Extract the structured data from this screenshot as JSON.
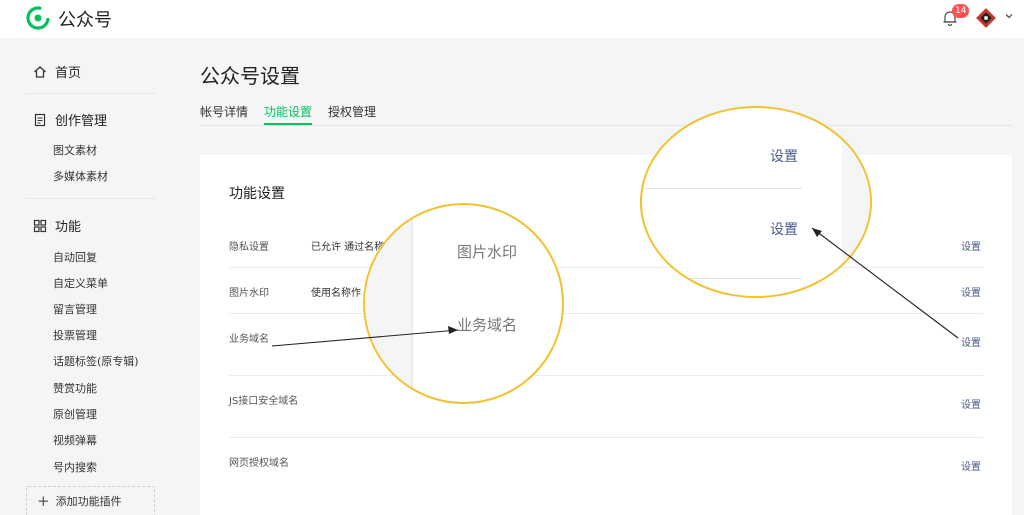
{
  "header": {
    "brand": "公众号",
    "notification_count": "14",
    "brand_color": "#07c160"
  },
  "sidebar": {
    "home": "首页",
    "creation": {
      "label": "创作管理",
      "items": [
        "图文素材",
        "多媒体素材"
      ]
    },
    "features": {
      "label": "功能",
      "items": [
        "自动回复",
        "自定义菜单",
        "留言管理",
        "投票管理",
        "话题标签(原专辑)",
        "赞赏功能",
        "原创管理",
        "视频弹幕",
        "号内搜索"
      ]
    },
    "add_plugin": "添加功能插件"
  },
  "main": {
    "title": "公众号设置",
    "tabs": [
      {
        "label": "帐号详情",
        "active": false
      },
      {
        "label": "功能设置",
        "active": true
      },
      {
        "label": "授权管理",
        "active": false
      }
    ],
    "card_title": "功能设置",
    "rows": [
      {
        "label": "隐私设置",
        "value": "已允许 通过名称",
        "action": "设置"
      },
      {
        "label": "图片水印",
        "value": "使用名称作",
        "action": "设置"
      },
      {
        "label": "业务域名",
        "value": "",
        "action": "设置"
      },
      {
        "label": "JS接口安全域名",
        "value": "",
        "action": "设置"
      },
      {
        "label": "网页授权域名",
        "value": "",
        "action": "设置"
      }
    ]
  },
  "zoom_left": {
    "line1": "图片水印",
    "line2": "业务域名"
  },
  "zoom_right": {
    "line1": "设置",
    "line2": "设置"
  }
}
